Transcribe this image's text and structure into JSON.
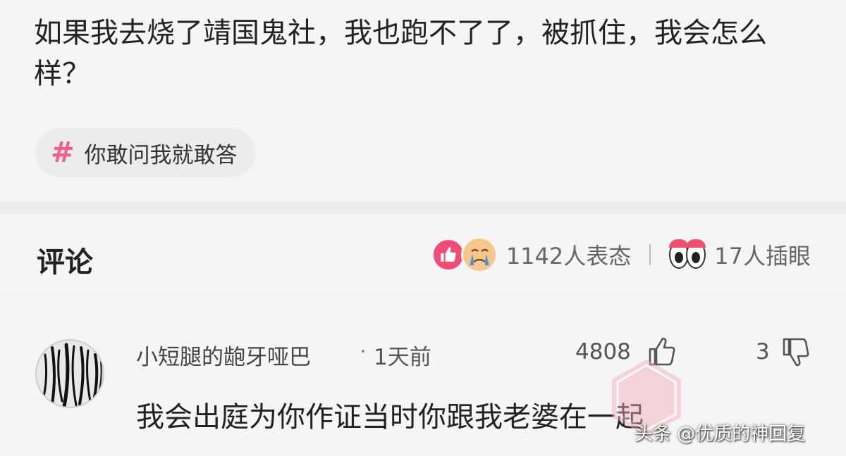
{
  "question": {
    "text": "如果我去烧了靖国鬼社，我也跑不了了，被抓住，我会怎么样？"
  },
  "topic": {
    "hash": "#",
    "label": "你敢问我就敢答"
  },
  "comments_header": {
    "title": "评论",
    "reactions_text": "1142人表态",
    "eyes_text": "17人插眼"
  },
  "comment": {
    "author": "小短腿的龅牙哑巴",
    "dot": "·",
    "time": "1天前",
    "likes": "4808",
    "dislikes": "3",
    "body": "我会出庭为你作证当时你跟我老婆在一起"
  },
  "watermark": {
    "text": "头条 @优质的神回复"
  },
  "icons": {
    "topic": "hashtag-icon",
    "reaction_like": "thumbs-up-badge-icon",
    "reaction_cry": "crying-face-icon",
    "eyes": "eyes-icon",
    "like": "thumbs-up-icon",
    "dislike": "thumbs-down-icon"
  },
  "colors": {
    "accent_pink": "#f24b78",
    "hash_pink": "#f0608a",
    "text_main": "#222222",
    "text_muted": "#666666"
  }
}
